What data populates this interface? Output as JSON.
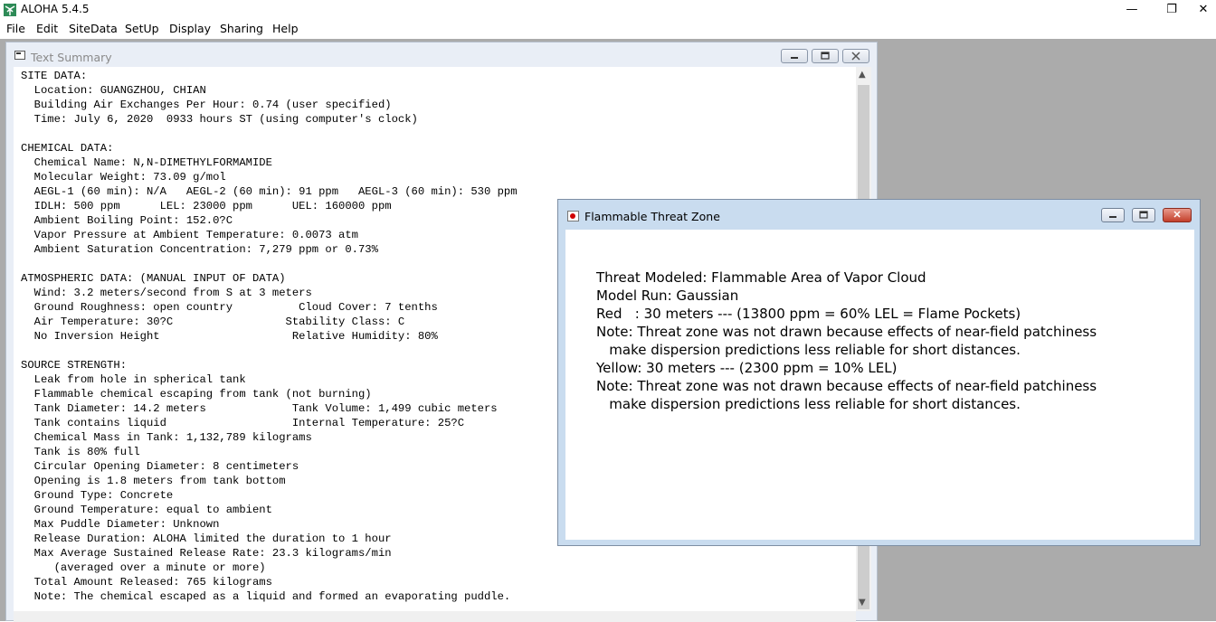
{
  "app": {
    "title": "ALOHA 5.4.5",
    "minimize": "—",
    "restore": "❐",
    "close": "✕"
  },
  "menu": [
    {
      "label": "File"
    },
    {
      "label": "Edit"
    },
    {
      "label": "SiteData"
    },
    {
      "label": "SetUp"
    },
    {
      "label": "Display"
    },
    {
      "label": "Sharing"
    },
    {
      "label": "Help"
    }
  ],
  "text_summary": {
    "title": "Text Summary",
    "lines": [
      "SITE DATA:",
      "  Location: GUANGZHOU, CHIAN",
      "  Building Air Exchanges Per Hour: 0.74 (user specified)",
      "  Time: July 6, 2020  0933 hours ST (using computer's clock)",
      "",
      "CHEMICAL DATA:",
      "  Chemical Name: N,N-DIMETHYLFORMAMIDE",
      "  Molecular Weight: 73.09 g/mol",
      "  AEGL-1 (60 min): N/A   AEGL-2 (60 min): 91 ppm   AEGL-3 (60 min): 530 ppm",
      "  IDLH: 500 ppm      LEL: 23000 ppm      UEL: 160000 ppm",
      "  Ambient Boiling Point: 152.0?C",
      "  Vapor Pressure at Ambient Temperature: 0.0073 atm",
      "  Ambient Saturation Concentration: 7,279 ppm or 0.73%",
      "",
      "ATMOSPHERIC DATA: (MANUAL INPUT OF DATA)",
      "  Wind: 3.2 meters/second from S at 3 meters",
      "  Ground Roughness: open country          Cloud Cover: 7 tenths",
      "  Air Temperature: 30?C                 Stability Class: C",
      "  No Inversion Height                    Relative Humidity: 80%",
      "",
      "SOURCE STRENGTH:",
      "  Leak from hole in spherical tank",
      "  Flammable chemical escaping from tank (not burning)",
      "  Tank Diameter: 14.2 meters             Tank Volume: 1,499 cubic meters",
      "  Tank contains liquid                   Internal Temperature: 25?C",
      "  Chemical Mass in Tank: 1,132,789 kilograms",
      "  Tank is 80% full",
      "  Circular Opening Diameter: 8 centimeters",
      "  Opening is 1.8 meters from tank bottom",
      "  Ground Type: Concrete",
      "  Ground Temperature: equal to ambient",
      "  Max Puddle Diameter: Unknown",
      "  Release Duration: ALOHA limited the duration to 1 hour",
      "  Max Average Sustained Release Rate: 23.3 kilograms/min",
      "     (averaged over a minute or more)",
      "  Total Amount Released: 765 kilograms",
      "  Note: The chemical escaped as a liquid and formed an evaporating puddle."
    ]
  },
  "threat_zone": {
    "title": "Flammable Threat Zone",
    "close": "✕",
    "lines": [
      "Threat Modeled: Flammable Area of Vapor Cloud",
      "Model Run: Gaussian",
      "Red   : 30 meters --- (13800 ppm = 60% LEL = Flame Pockets)",
      "Note: Threat zone was not drawn because effects of near-field patchiness",
      "   make dispersion predictions less reliable for short distances.",
      "Yellow: 30 meters --- (2300 ppm = 10% LEL)",
      "Note: Threat zone was not drawn because effects of near-field patchiness",
      "   make dispersion predictions less reliable for short distances."
    ]
  }
}
